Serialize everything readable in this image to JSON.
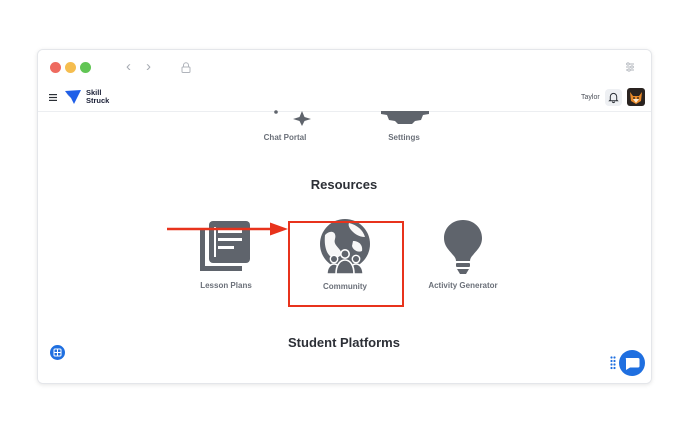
{
  "browser": {
    "traffic_lights": [
      "#ee6a5f",
      "#f5bd4f",
      "#61c554"
    ],
    "back_icon": "chevron-left-icon",
    "forward_icon": "chevron-right-icon",
    "lock_icon": "lock-icon",
    "settings_icon": "sliders-icon"
  },
  "app": {
    "logo_line1": "Skill",
    "logo_line2": "Struck",
    "user_name": "Taylor",
    "bell_icon": "bell-icon"
  },
  "tiles_top": [
    {
      "label": "Chat Portal",
      "icon": "sparkle-icon"
    },
    {
      "label": "Settings",
      "icon": "gear-icon"
    }
  ],
  "resources": {
    "title": "Resources",
    "items": [
      {
        "label": "Lesson Plans",
        "icon": "library-icon"
      },
      {
        "label": "Community",
        "icon": "globe-people-icon"
      },
      {
        "label": "Activity Generator",
        "icon": "lightbulb-icon"
      }
    ]
  },
  "student_platforms": {
    "title": "Student Platforms"
  },
  "annotation": {
    "color": "#e8331c"
  }
}
